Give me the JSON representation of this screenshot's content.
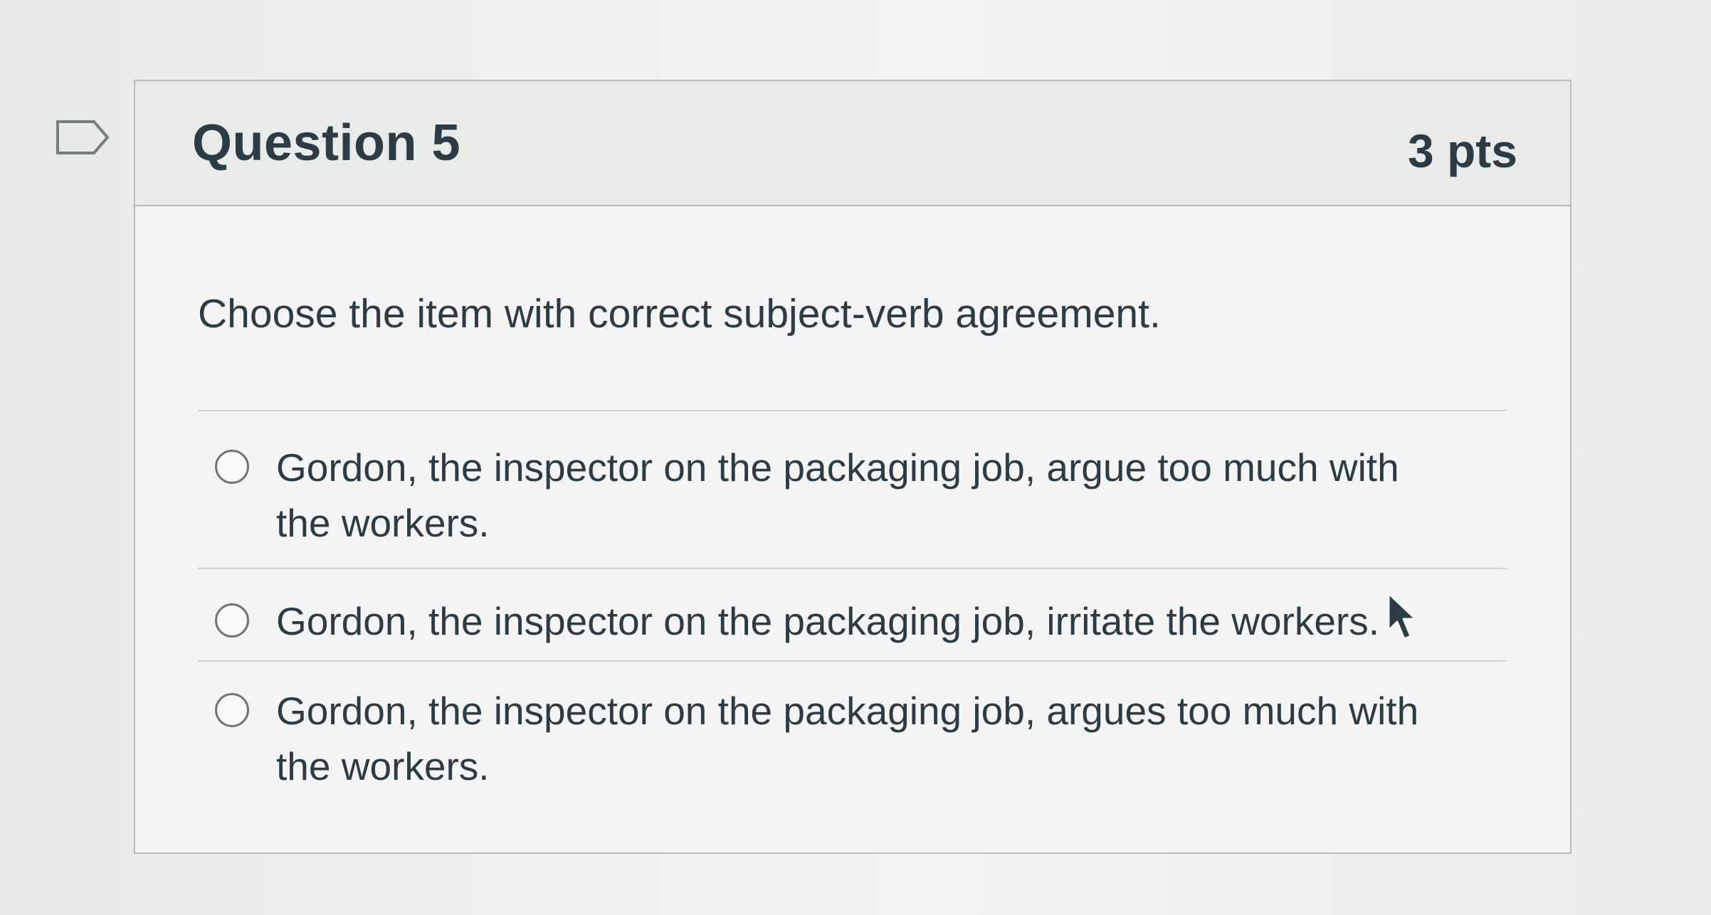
{
  "question": {
    "title": "Question 5",
    "points": "3 pts",
    "prompt": "Choose the item with correct subject-verb agreement."
  },
  "answers": [
    {
      "label": "Gordon, the inspector on the packaging job, argue too much with the workers.",
      "selected": false
    },
    {
      "label": "Gordon, the inspector on the packaging job, irritate the workers.",
      "selected": false
    },
    {
      "label": "Gordon, the inspector on the packaging job, argues too much with the workers.",
      "selected": false
    }
  ],
  "icons": {
    "flag": "flag-outline-icon",
    "cursor": "mouse-pointer-icon"
  },
  "colors": {
    "text": "#2d3b45",
    "border": "#b8bcbf",
    "header_bg": "#e9ebea",
    "card_bg": "#f3f4f3"
  }
}
